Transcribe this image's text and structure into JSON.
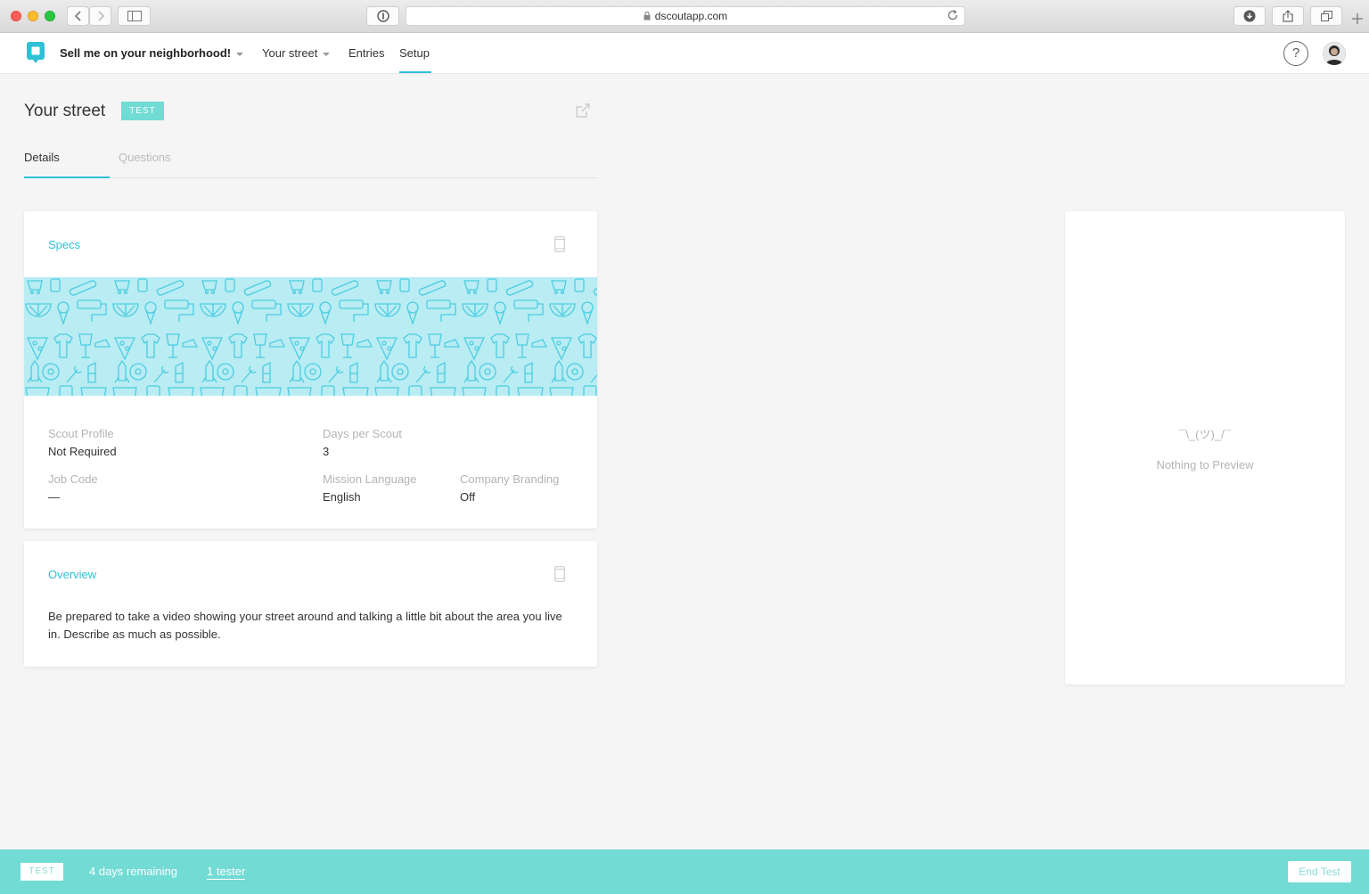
{
  "browser": {
    "url": "dscoutapp.com"
  },
  "header": {
    "mission_title": "Sell me on your neighborhood!",
    "part_label": "Your street",
    "entries_label": "Entries",
    "setup_label": "Setup",
    "help_label": "?"
  },
  "page": {
    "title": "Your street",
    "badge": "TEST",
    "tabs": [
      {
        "label": "Details",
        "active": true
      },
      {
        "label": "Questions",
        "active": false
      }
    ]
  },
  "specs": {
    "title": "Specs",
    "fields": [
      {
        "label": "Scout Profile",
        "value": "Not Required"
      },
      {
        "label": "Days per Scout",
        "value": "3"
      },
      {
        "label": "Job Code",
        "value": "—"
      },
      {
        "label": "Mission Language",
        "value": "English"
      },
      {
        "label": "Company Branding",
        "value": "Off"
      }
    ]
  },
  "overview": {
    "title": "Overview",
    "text": "Be prepared to take a video showing your street around and talking a little bit about the area you live in. Describe as much as possible."
  },
  "preview": {
    "shrug": "¯\\_(ツ)_/¯",
    "empty_text": "Nothing to Preview"
  },
  "footer": {
    "badge": "TEST",
    "days_remaining": "4 days remaining",
    "testers": "1 tester",
    "end_button": "End Test"
  },
  "colors": {
    "accent": "#30c0d6",
    "footer_bg": "#71dbd4",
    "badge_bg": "#71dbd4",
    "banner_bg": "#b9ecf3"
  }
}
